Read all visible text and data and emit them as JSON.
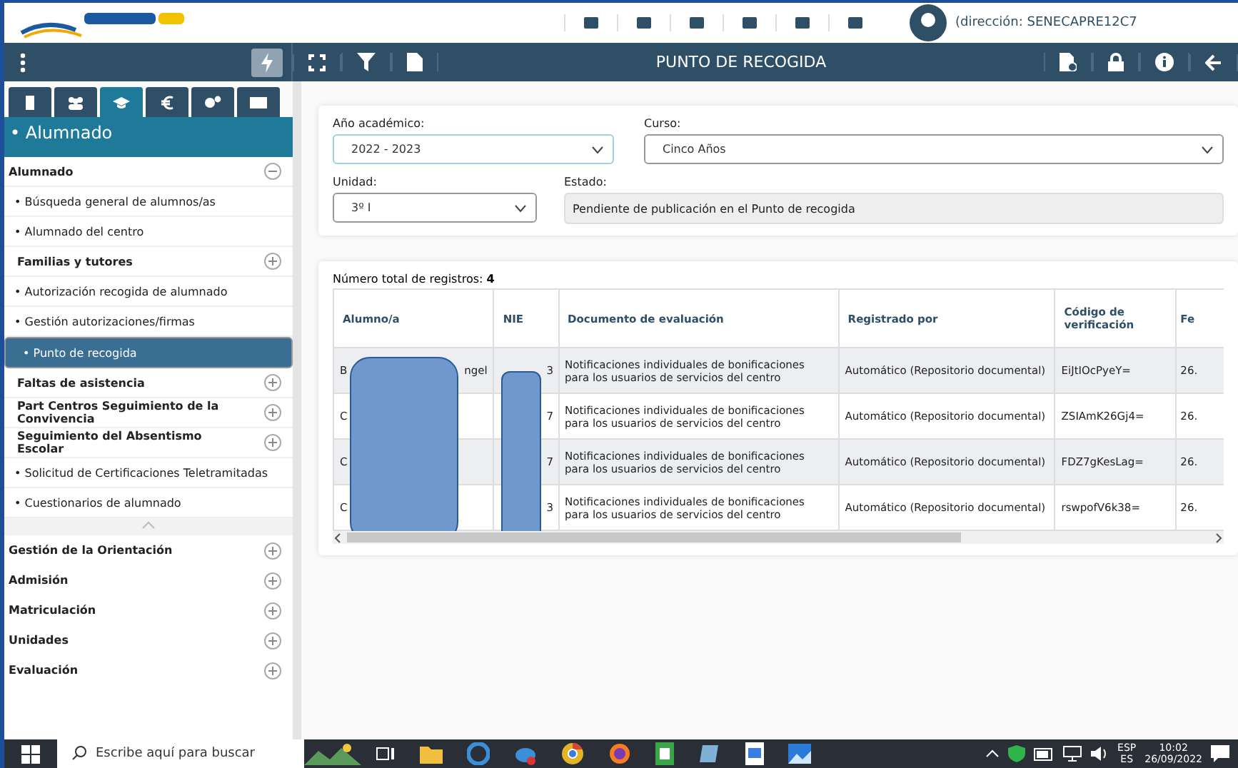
{
  "header": {
    "user": "(dirección: SENECAPRE12C7"
  },
  "toolbar": {
    "title": "PUNTO DE RECOGIDA"
  },
  "sidebar": {
    "tabs": [
      {
        "selected": false
      },
      {
        "selected": false
      },
      {
        "selected": true
      },
      {
        "selected": false
      },
      {
        "selected": false
      },
      {
        "selected": false
      }
    ],
    "heading": "• Alumnado",
    "section": {
      "label": "Alumnado",
      "expanded": true
    },
    "items": [
      {
        "kind": "link",
        "label": "• Búsqueda general de alumnos/as",
        "selected": false
      },
      {
        "kind": "link",
        "label": "• Alumnado del centro",
        "selected": false
      },
      {
        "kind": "group",
        "label": "Familias y tutores",
        "expanded": false
      },
      {
        "kind": "link",
        "label": "• Autorización recogida de alumnado",
        "selected": false
      },
      {
        "kind": "link",
        "label": "• Gestión autorizaciones/firmas",
        "selected": false
      },
      {
        "kind": "link",
        "label": "• Punto de recogida",
        "selected": true
      },
      {
        "kind": "group",
        "label": "Faltas de asistencia",
        "expanded": false
      },
      {
        "kind": "group",
        "label": "Part Centros Seguimiento de la Convivencia",
        "expanded": false
      },
      {
        "kind": "group",
        "label": "Seguimiento del Absentismo Escolar",
        "expanded": false
      },
      {
        "kind": "link",
        "label": "• Solicitud de Certificaciones Teletramitadas",
        "selected": false
      },
      {
        "kind": "link",
        "label": "• Cuestionarios de alumnado",
        "selected": false
      }
    ],
    "groups": [
      {
        "label": "Gestión de la Orientación",
        "expanded": false
      },
      {
        "label": "Admisión",
        "expanded": false
      },
      {
        "label": "Matriculación",
        "expanded": false
      },
      {
        "label": "Unidades",
        "expanded": false
      },
      {
        "label": "Evaluación",
        "expanded": false
      }
    ]
  },
  "filters": {
    "year": {
      "label": "Año académico:",
      "value": "2022 - 2023"
    },
    "course": {
      "label": "Curso:",
      "value": "Cinco Años"
    },
    "unit": {
      "label": "Unidad:",
      "value": "3º I"
    },
    "status": {
      "label": "Estado:",
      "value": "Pendiente de publicación en el Punto de recogida"
    }
  },
  "records": {
    "total_label": "Número total de registros:",
    "total": "4"
  },
  "table": {
    "columns": [
      "Alumno/a",
      "NIE",
      "Documento de evaluación",
      "Registrado por",
      "Código de verificación",
      "Fe"
    ],
    "rows": [
      {
        "alumno_start": "B",
        "alumno_end": "ngel",
        "nie": "3",
        "documento": "Notificaciones individuales de bonificaciones para los usuarios de servicios del centro",
        "registrado": "Automático (Repositorio documental)",
        "codigo": "EiJtIOcPyeY=",
        "fecha": "26."
      },
      {
        "alumno_start": "C",
        "alumno_end": "",
        "nie": "7",
        "documento": "Notificaciones individuales de bonificaciones para los usuarios de servicios del centro",
        "registrado": "Automático (Repositorio documental)",
        "codigo": "ZSIAmK26Gj4=",
        "fecha": "26."
      },
      {
        "alumno_start": "C",
        "alumno_end": "",
        "nie": "7",
        "documento": "Notificaciones individuales de bonificaciones para los usuarios de servicios del centro",
        "registrado": "Automático (Repositorio documental)",
        "codigo": "FDZ7gKesLag=",
        "fecha": "26."
      },
      {
        "alumno_start": "C",
        "alumno_end": "",
        "nie": "3",
        "documento": "Notificaciones individuales de bonificaciones para los usuarios de servicios del centro",
        "registrado": "Automático (Repositorio documental)",
        "codigo": "rswpofV6k38=",
        "fecha": "26."
      }
    ]
  },
  "taskbar": {
    "search_placeholder": "Escribe aquí para buscar",
    "lang_top": "ESP",
    "lang_bottom": "ES",
    "time": "10:02",
    "date": "26/09/2022"
  }
}
